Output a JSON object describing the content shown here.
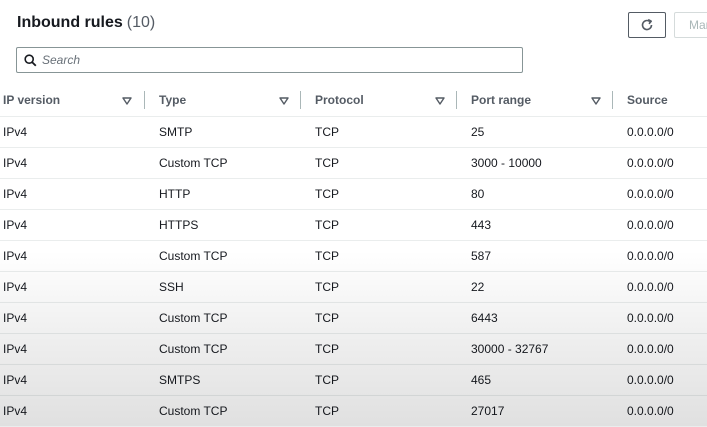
{
  "header": {
    "title": "Inbound rules",
    "count": "(10)",
    "manage_label": "Manage"
  },
  "search": {
    "placeholder": "Search",
    "value": ""
  },
  "columns": [
    {
      "label": "IP version",
      "sort_icon": "caret-down-icon"
    },
    {
      "label": "Type",
      "sort_icon": "caret-down-icon"
    },
    {
      "label": "Protocol",
      "sort_icon": "caret-down-icon"
    },
    {
      "label": "Port range",
      "sort_icon": "caret-down-icon"
    },
    {
      "label": "Source"
    }
  ],
  "rows": [
    {
      "ip": "IPv4",
      "type": "SMTP",
      "protocol": "TCP",
      "port": "25",
      "source": "0.0.0.0/0"
    },
    {
      "ip": "IPv4",
      "type": "Custom TCP",
      "protocol": "TCP",
      "port": "3000 - 10000",
      "source": "0.0.0.0/0"
    },
    {
      "ip": "IPv4",
      "type": "HTTP",
      "protocol": "TCP",
      "port": "80",
      "source": "0.0.0.0/0"
    },
    {
      "ip": "IPv4",
      "type": "HTTPS",
      "protocol": "TCP",
      "port": "443",
      "source": "0.0.0.0/0"
    },
    {
      "ip": "IPv4",
      "type": "Custom TCP",
      "protocol": "TCP",
      "port": "587",
      "source": "0.0.0.0/0"
    },
    {
      "ip": "IPv4",
      "type": "SSH",
      "protocol": "TCP",
      "port": "22",
      "source": "0.0.0.0/0"
    },
    {
      "ip": "IPv4",
      "type": "Custom TCP",
      "protocol": "TCP",
      "port": "6443",
      "source": "0.0.0.0/0"
    },
    {
      "ip": "IPv4",
      "type": "Custom TCP",
      "protocol": "TCP",
      "port": "30000 - 32767",
      "source": "0.0.0.0/0"
    },
    {
      "ip": "IPv4",
      "type": "SMTPS",
      "protocol": "TCP",
      "port": "465",
      "source": "0.0.0.0/0"
    },
    {
      "ip": "IPv4",
      "type": "Custom TCP",
      "protocol": "TCP",
      "port": "27017",
      "source": "0.0.0.0/0"
    }
  ],
  "icons": {
    "refresh": "refresh-icon",
    "search": "search-icon"
  },
  "colors": {
    "text": "#16191f",
    "header_text": "#545b64",
    "border": "#879596"
  }
}
